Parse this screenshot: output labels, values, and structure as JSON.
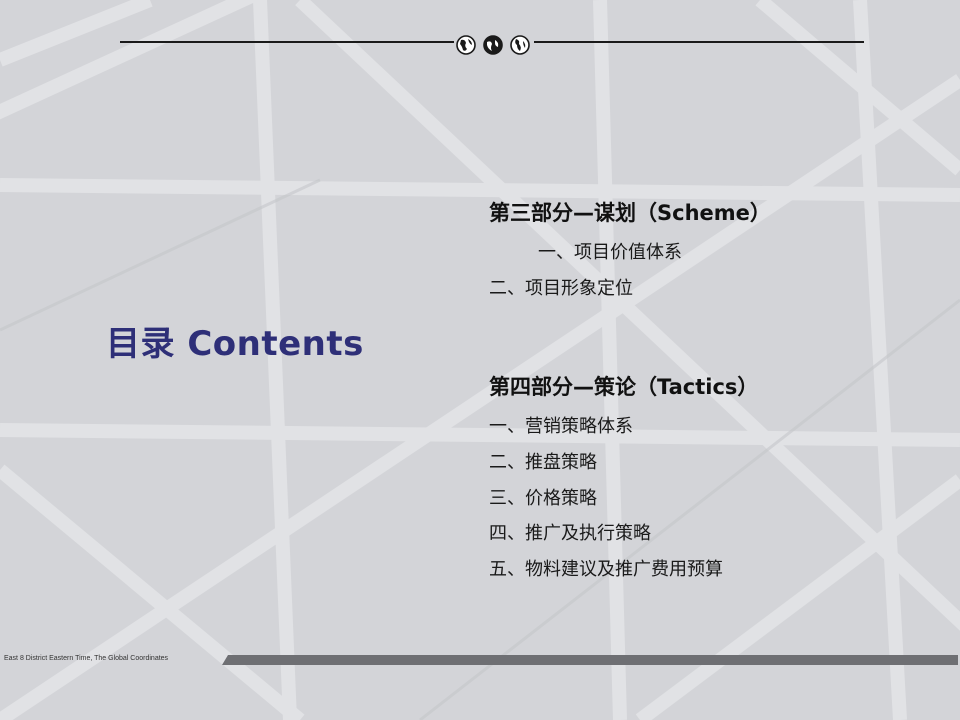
{
  "header": {
    "globe_icons": [
      "globe-icon",
      "globe-icon",
      "globe-icon"
    ]
  },
  "title": "目录 Contents",
  "sections": [
    {
      "heading": "第三部分—谋划（Scheme）",
      "items": [
        "一、项目价值体系",
        "二、项目形象定位"
      ]
    },
    {
      "heading": "第四部分—策论（Tactics）",
      "items": [
        "一、营销策略体系",
        "二、推盘策略",
        "三、价格策略",
        "四、推广及执行策略",
        "五、物料建议及推广费用预算"
      ]
    }
  ],
  "footer": {
    "text": "East 8  District Eastern Time, The Global Coordinates"
  },
  "colors": {
    "title": "#2e2f78",
    "background": "#d3d4d8",
    "footer_bar": "#6e6f73"
  }
}
